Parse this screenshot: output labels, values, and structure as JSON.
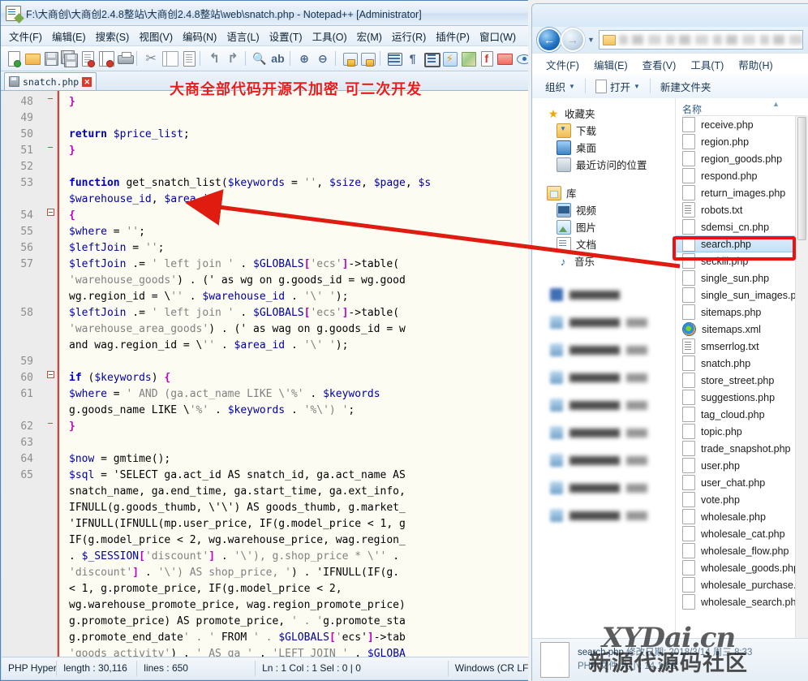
{
  "notepad": {
    "title": "F:\\大商创\\大商创2.4.8整站\\大商创2.4.8整站\\web\\snatch.php - Notepad++ [Administrator]",
    "title_icon": "notepad-plus-plus-icon",
    "menus": [
      "文件(F)",
      "编辑(E)",
      "搜索(S)",
      "视图(V)",
      "编码(N)",
      "语言(L)",
      "设置(T)",
      "工具(O)",
      "宏(M)",
      "运行(R)",
      "插件(P)",
      "窗口(W)"
    ],
    "toolbar_icons": [
      "new-file-icon",
      "open-file-icon",
      "save-icon",
      "save-all-icon",
      "close-file-icon",
      "close-all-icon",
      "print-icon",
      "cut-icon",
      "copy-icon",
      "paste-icon",
      "undo-icon",
      "redo-icon",
      "find-icon",
      "replace-icon",
      "zoom-in-icon",
      "zoom-out-icon",
      "sync-vertical-scroll-icon",
      "sync-horizontal-scroll-icon",
      "word-wrap-icon",
      "show-all-characters-icon",
      "indent-guide-icon",
      "user-defined-language-icon",
      "document-map-icon",
      "function-list-icon",
      "folder-as-workspace-icon",
      "monitoring-icon"
    ],
    "tab": {
      "label": "snatch.php",
      "save_icon": "floppy-icon",
      "close_icon": "close-icon"
    },
    "annotation": "大商全部代码开源不加密 可二次开发",
    "status": {
      "language": "PHP Hyperte",
      "length": "length : 30,116",
      "lines": "lines : 650",
      "position": "Ln : 1    Col : 1    Sel : 0 | 0",
      "eol": "Windows (CR LF)"
    },
    "code_lines": [
      {
        "n": "48",
        "fold": "end",
        "text": "    }"
      },
      {
        "n": "49",
        "fold": "",
        "text": ""
      },
      {
        "n": "50",
        "fold": "",
        "text": "    return $price_list;"
      },
      {
        "n": "51",
        "fold": "end",
        "text": "}"
      },
      {
        "n": "52",
        "fold": "",
        "text": ""
      },
      {
        "n": "53",
        "fold": "",
        "text": "function get_snatch_list($keywords = '', $size, $page, $s"
      },
      {
        "n": "",
        "fold": "",
        "text": "$warehouse_id, $area_id)"
      },
      {
        "n": "54",
        "fold": "open",
        "text": "{"
      },
      {
        "n": "55",
        "fold": "",
        "text": "    $where = '';"
      },
      {
        "n": "56",
        "fold": "",
        "text": "    $leftJoin = '';"
      },
      {
        "n": "57",
        "fold": "",
        "text": "    $leftJoin .= ' left join ' . $GLOBALS['ecs']->table("
      },
      {
        "n": "",
        "fold": "",
        "text": "    'warehouse_goods') . (' as wg on g.goods_id = wg.good"
      },
      {
        "n": "",
        "fold": "",
        "text": "    wg.region_id = \\'' . $warehouse_id . '\\' ');"
      },
      {
        "n": "58",
        "fold": "",
        "text": "    $leftJoin .= ' left join ' . $GLOBALS['ecs']->table("
      },
      {
        "n": "",
        "fold": "",
        "text": "    'warehouse_area_goods') . (' as wag on g.goods_id = w"
      },
      {
        "n": "",
        "fold": "",
        "text": "    and wag.region_id = \\'' . $area_id . '\\' ');"
      },
      {
        "n": "59",
        "fold": "",
        "text": ""
      },
      {
        "n": "60",
        "fold": "open",
        "text": "    if ($keywords) {"
      },
      {
        "n": "61",
        "fold": "",
        "text": "        $where = ' AND (ga.act_name LIKE \\'%' . $keywords"
      },
      {
        "n": "",
        "fold": "",
        "text": "        g.goods_name LIKE \\'%' . $keywords . '%\\') ';"
      },
      {
        "n": "62",
        "fold": "end",
        "text": "    }"
      },
      {
        "n": "63",
        "fold": "",
        "text": ""
      },
      {
        "n": "64",
        "fold": "",
        "text": "    $now = gmtime();"
      },
      {
        "n": "65",
        "fold": "",
        "text": "    $sql = 'SELECT ga.act_id AS snatch_id, ga.act_name AS"
      },
      {
        "n": "",
        "fold": "",
        "text": "    snatch_name, ga.end_time, ga.start_time, ga.ext_info,"
      },
      {
        "n": "",
        "fold": "",
        "text": "    IFNULL(g.goods_thumb, \\'\\') AS goods_thumb, g.market_"
      },
      {
        "n": "",
        "fold": "",
        "text": "    'IFNULL(IFNULL(mp.user_price, IF(g.model_price < 1, g"
      },
      {
        "n": "",
        "fold": "",
        "text": "    IF(g.model_price < 2, wg.warehouse_price, wag.region_"
      },
      {
        "n": "",
        "fold": "",
        "text": "     . $_SESSION['discount'] . '\\'), g.shop_price * \\'' ."
      },
      {
        "n": "",
        "fold": "",
        "text": "    'discount'] . '\\')  AS shop_price, ') . 'IFNULL(IF(g."
      },
      {
        "n": "",
        "fold": "",
        "text": "    < 1, g.promote_price, IF(g.model_price < 2,"
      },
      {
        "n": "",
        "fold": "",
        "text": "    wg.warehouse_promote_price, wag.region_promote_price)"
      },
      {
        "n": "",
        "fold": "",
        "text": "    g.promote_price) AS promote_price, ' . 'g.promote_sta"
      },
      {
        "n": "",
        "fold": "",
        "text": "    g.promote_end_date' . ' FROM ' . $GLOBALS['ecs']->tab"
      },
      {
        "n": "",
        "fold": "",
        "text": "    'goods_activity') . ' AS ga ' . 'LEFT JOIN ' . $GLOBA"
      }
    ]
  },
  "explorer": {
    "nav": {
      "back_icon": "back-arrow-icon",
      "forward_icon": "forward-arrow-icon",
      "dropdown_icon": "chevron-down-icon",
      "address_value": "",
      "address_folder_icon": "folder-icon"
    },
    "menus": [
      "文件(F)",
      "编辑(E)",
      "查看(V)",
      "工具(T)",
      "帮助(H)"
    ],
    "commands": [
      {
        "label": "组织",
        "caret": "▼",
        "icon": ""
      },
      {
        "label": "打开",
        "caret": "▼",
        "icon": "open-file-icon"
      },
      {
        "label": "新建文件夹",
        "caret": "",
        "icon": ""
      }
    ],
    "tree": [
      {
        "label": "收藏夹",
        "icon": "favorites-star-icon",
        "level": 0,
        "gap": false
      },
      {
        "label": "下载",
        "icon": "downloads-icon",
        "level": 1,
        "gap": false
      },
      {
        "label": "桌面",
        "icon": "desktop-icon",
        "level": 1,
        "gap": false
      },
      {
        "label": "最近访问的位置",
        "icon": "recent-places-icon",
        "level": 1,
        "gap": false
      },
      {
        "label": "库",
        "icon": "libraries-icon",
        "level": 0,
        "gap": true
      },
      {
        "label": "视频",
        "icon": "videos-icon",
        "level": 1,
        "gap": false
      },
      {
        "label": "图片",
        "icon": "pictures-icon",
        "level": 1,
        "gap": false
      },
      {
        "label": "文档",
        "icon": "documents-icon",
        "level": 1,
        "gap": false
      },
      {
        "label": "音乐",
        "icon": "music-icon",
        "level": 1,
        "gap": false
      }
    ],
    "tree_blurred_count": 9,
    "list_header": "名称",
    "sort_indicator": "▲",
    "files": [
      {
        "name": "receive.php",
        "icon": "php-file-icon",
        "selected": false
      },
      {
        "name": "region.php",
        "icon": "php-file-icon",
        "selected": false
      },
      {
        "name": "region_goods.php",
        "icon": "php-file-icon",
        "selected": false
      },
      {
        "name": "respond.php",
        "icon": "php-file-icon",
        "selected": false
      },
      {
        "name": "return_images.php",
        "icon": "php-file-icon",
        "selected": false
      },
      {
        "name": "robots.txt",
        "icon": "text-file-icon",
        "selected": false
      },
      {
        "name": "sdemsi_cn.php",
        "icon": "php-file-icon",
        "selected": false
      },
      {
        "name": "search.php",
        "icon": "php-file-icon",
        "selected": true
      },
      {
        "name": "seckill.php",
        "icon": "php-file-icon",
        "selected": false
      },
      {
        "name": "single_sun.php",
        "icon": "php-file-icon",
        "selected": false
      },
      {
        "name": "single_sun_images.php",
        "icon": "php-file-icon",
        "selected": false
      },
      {
        "name": "sitemaps.php",
        "icon": "php-file-icon",
        "selected": false
      },
      {
        "name": "sitemaps.xml",
        "icon": "xml-file-icon",
        "selected": false
      },
      {
        "name": "smserrlog.txt",
        "icon": "text-file-icon",
        "selected": false
      },
      {
        "name": "snatch.php",
        "icon": "php-file-icon",
        "selected": false
      },
      {
        "name": "store_street.php",
        "icon": "php-file-icon",
        "selected": false
      },
      {
        "name": "suggestions.php",
        "icon": "php-file-icon",
        "selected": false
      },
      {
        "name": "tag_cloud.php",
        "icon": "php-file-icon",
        "selected": false
      },
      {
        "name": "topic.php",
        "icon": "php-file-icon",
        "selected": false
      },
      {
        "name": "trade_snapshot.php",
        "icon": "php-file-icon",
        "selected": false
      },
      {
        "name": "user.php",
        "icon": "php-file-icon",
        "selected": false
      },
      {
        "name": "user_chat.php",
        "icon": "php-file-icon",
        "selected": false
      },
      {
        "name": "vote.php",
        "icon": "php-file-icon",
        "selected": false
      },
      {
        "name": "wholesale.php",
        "icon": "php-file-icon",
        "selected": false
      },
      {
        "name": "wholesale_cat.php",
        "icon": "php-file-icon",
        "selected": false
      },
      {
        "name": "wholesale_flow.php",
        "icon": "php-file-icon",
        "selected": false
      },
      {
        "name": "wholesale_goods.php",
        "icon": "php-file-icon",
        "selected": false
      },
      {
        "name": "wholesale_purchase.php",
        "icon": "php-file-icon",
        "selected": false
      },
      {
        "name": "wholesale_search.php",
        "icon": "php-file-icon",
        "selected": false
      }
    ],
    "details": {
      "file_icon": "php-file-icon",
      "name": "search.php",
      "modified_label": "修改日期:",
      "modified_value": "2018/3/14 周三 8:33",
      "type_label": "PHP 文件",
      "size_label": "大小: 14.1 KB"
    }
  },
  "overlay": {
    "highlight_color": "#ee1111",
    "arrow_color": "#e01b10",
    "arrow_label": "red-pointer-arrow"
  },
  "watermark": {
    "line1": "XYDai.cn",
    "line2": "新源代源码社区"
  }
}
